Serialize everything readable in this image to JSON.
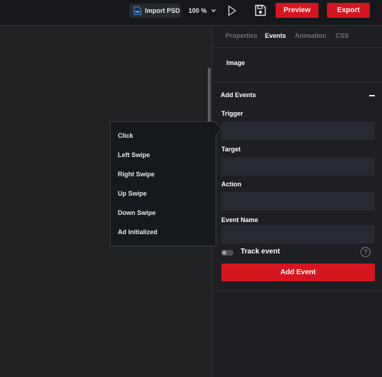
{
  "toolbar": {
    "import_label": "Import PSD",
    "import_icon": "file-psd-icon",
    "zoom_value": "100 %",
    "play_icon": "play-icon",
    "save_icon": "save-icon",
    "preview_label": "Preview",
    "export_label": "Export",
    "accent": "#d5161e"
  },
  "dropdown": {
    "items": [
      "Click",
      "Left Swipe",
      "Right Swipe",
      "Up Swipe",
      "Down Swipe",
      "Ad Initialized"
    ]
  },
  "panel": {
    "tabs": [
      {
        "label": "Properties",
        "active": false
      },
      {
        "label": "Events",
        "active": true
      },
      {
        "label": "Animation",
        "active": false
      },
      {
        "label": "CSS",
        "active": false
      }
    ],
    "element_name": "Image",
    "section_title": "Add Events",
    "fields": [
      {
        "label": "Trigger",
        "value": ""
      },
      {
        "label": "Target",
        "value": ""
      },
      {
        "label": "Action",
        "value": ""
      },
      {
        "label": "Event Name",
        "value": ""
      }
    ],
    "track_event_label": "Track event",
    "track_event_on": false,
    "help_glyph": "?",
    "add_event_label": "Add Event"
  }
}
